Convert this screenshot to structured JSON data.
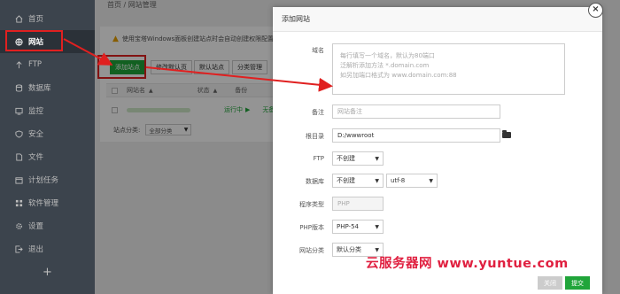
{
  "sidebar": {
    "items": [
      {
        "label": "首页",
        "icon": "home-icon"
      },
      {
        "label": "网站",
        "icon": "globe-icon"
      },
      {
        "label": "FTP",
        "icon": "ftp-icon"
      },
      {
        "label": "数据库",
        "icon": "database-icon"
      },
      {
        "label": "监控",
        "icon": "monitor-icon"
      },
      {
        "label": "安全",
        "icon": "shield-icon"
      },
      {
        "label": "文件",
        "icon": "file-icon"
      },
      {
        "label": "计划任务",
        "icon": "calendar-icon"
      },
      {
        "label": "软件管理",
        "icon": "grid-icon"
      },
      {
        "label": "设置",
        "icon": "gear-icon"
      },
      {
        "label": "退出",
        "icon": "logout-icon"
      }
    ],
    "add_label": "+"
  },
  "main": {
    "breadcrumb": "首页 / 网站管理",
    "warning": "使用宝塔Windows面板创建站点时会自动创建权限配置",
    "toolbar": {
      "add_site": "添加站点",
      "default_page": "修改默认页",
      "default_site": "默认站点",
      "category_manage": "分类管理"
    },
    "table": {
      "col_name": "网站名",
      "col_status": "状态",
      "col_backup": "备份",
      "row_status": "运行中",
      "row_backup": "无备份"
    },
    "category_label": "站点分类:",
    "category_value": "全部分类"
  },
  "modal": {
    "title": "添加网站",
    "close": "×",
    "domain_label": "域名",
    "domain_placeholder": [
      "每行填写一个域名，默认为80端口",
      "泛解析添加方法 *.domain.com",
      "如另加端口格式为 www.domain.com:88"
    ],
    "remark_label": "备注",
    "remark_placeholder": "网站备注",
    "root_label": "根目录",
    "root_value": "D:/wwwroot",
    "ftp_label": "FTP",
    "ftp_value": "不创建",
    "db_label": "数据库",
    "db_value": "不创建",
    "charset_value": "utf-8",
    "program_label": "程序类型",
    "program_value": "PHP",
    "php_label": "PHP版本",
    "php_value": "PHP-54",
    "category_label": "网站分类",
    "category_value": "默认分类",
    "cancel": "关闭",
    "submit": "提交"
  },
  "watermark": "云服务器网 www.yuntue.com",
  "colors": {
    "sidebar_bg": "#3c444d",
    "accent_green": "#20a53a",
    "highlight_red": "#e02020"
  }
}
